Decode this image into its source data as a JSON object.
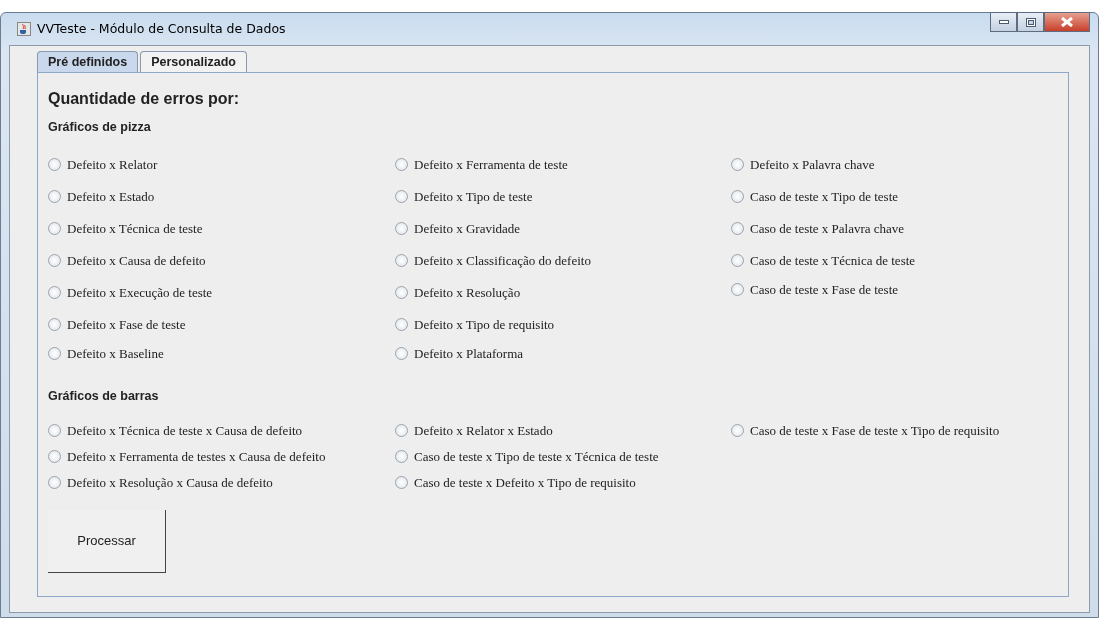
{
  "window": {
    "title": "VVTeste - Módulo de Consulta de Dados"
  },
  "tabs": [
    {
      "label": "Pré definidos",
      "selected": true
    },
    {
      "label": "Personalizado",
      "selected": false
    }
  ],
  "heading": "Quantidade de erros por:",
  "sections": [
    {
      "title": "Gráficos de pizza",
      "columns": [
        [
          {
            "label": "Defeito x Relator",
            "selected": false
          },
          {
            "label": "Defeito x Estado",
            "selected": false
          },
          {
            "label": "Defeito x Técnica de teste",
            "selected": false
          },
          {
            "label": "Defeito x Causa de defeito",
            "selected": false
          },
          {
            "label": "Defeito x Execução de teste",
            "selected": false
          },
          {
            "label": "Defeito x Fase de teste",
            "selected": false
          },
          {
            "label": "Defeito x Baseline",
            "selected": false
          }
        ],
        [
          {
            "label": "Defeito x Ferramenta de teste",
            "selected": false
          },
          {
            "label": "Defeito x Tipo de teste",
            "selected": false
          },
          {
            "label": "Defeito x Gravidade",
            "selected": false
          },
          {
            "label": "Defeito x Classificação do defeito",
            "selected": false
          },
          {
            "label": "Defeito x Resolução",
            "selected": false
          },
          {
            "label": "Defeito x Tipo de requisito",
            "selected": false
          },
          {
            "label": "Defeito x Plataforma",
            "selected": false
          }
        ],
        [
          {
            "label": "Defeito x Palavra chave",
            "selected": false
          },
          {
            "label": "Caso de teste x Tipo de teste",
            "selected": false
          },
          {
            "label": "Caso de teste x Palavra chave",
            "selected": false
          },
          {
            "label": "Caso de teste x Técnica de teste",
            "selected": false
          },
          {
            "label": "Caso de teste x Fase de teste",
            "selected": false
          }
        ]
      ]
    },
    {
      "title": "Gráficos de barras",
      "columns": [
        [
          {
            "label": "Defeito x Técnica de teste x Causa de defeito",
            "selected": false
          },
          {
            "label": "Defeito x Ferramenta de testes x Causa de defeito",
            "selected": false
          },
          {
            "label": "Defeito x Resolução x Causa de defeito",
            "selected": false
          }
        ],
        [
          {
            "label": "Defeito x Relator x Estado",
            "selected": false
          },
          {
            "label": "Caso de teste x Tipo de teste x Técnica de teste",
            "selected": false
          },
          {
            "label": "Caso de teste x Defeito x Tipo de requisito",
            "selected": false
          }
        ],
        [
          {
            "label": "Caso de teste x Fase de teste x Tipo de requisito",
            "selected": false
          }
        ]
      ]
    }
  ],
  "button": {
    "label": "Processar"
  }
}
